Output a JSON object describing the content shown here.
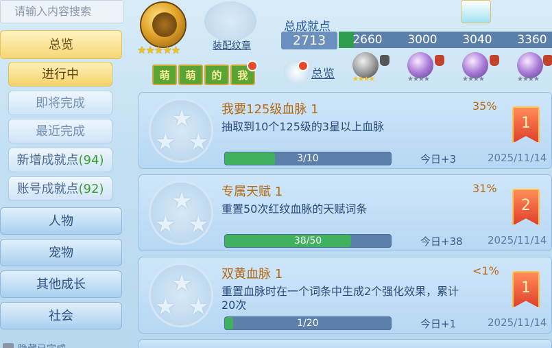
{
  "search": {
    "placeholder": "请输入内容搜索"
  },
  "sidebar": {
    "overview": "总览",
    "in_progress": "进行中",
    "about_to_finish": "即将完成",
    "recently_done": "最近完成",
    "new_points_label": "新增成就点",
    "new_points_count": "(94)",
    "account_points_label": "账号成就点",
    "account_points_count": "(92)",
    "categories": [
      "人物",
      "宠物",
      "其他成长",
      "社会"
    ],
    "hide_completed_label": "隐藏已完成"
  },
  "header": {
    "medal_stars": 5,
    "meng_tags": [
      "萌",
      "萌",
      "的",
      "我"
    ],
    "equip_label": "装配纹章",
    "total_title": "总成就点",
    "total_value": "2713",
    "milestones": [
      "2660",
      "3000",
      "3040",
      "3360"
    ],
    "milestone_progress_fraction": 0.07,
    "overview_link": "总览"
  },
  "colors": {
    "accent_gold": "#b4690f",
    "progress_green": "#3fb15f",
    "count_green": "#3a9f2e",
    "ribbon_red": "#e0402a"
  },
  "achievements": [
    {
      "title": "我要125级血脉 1",
      "percent": "35%",
      "description": "抽取到10个125级的3星以上血脉",
      "progress_text": "3/10",
      "progress": 0.3,
      "today": "今日+3",
      "date": "2025/11/14",
      "rank": "1"
    },
    {
      "title": "专属天赋 1",
      "percent": "31%",
      "description": "重置50次红纹血脉的天赋词条",
      "progress_text": "38/50",
      "progress": 0.76,
      "today": "今日+38",
      "date": "2025/11/14",
      "rank": "2"
    },
    {
      "title": "双黄血脉 1",
      "percent": "<1%",
      "description": "重置血脉时在一个词条中生成2个强化效果，累计20次",
      "progress_text": "1/20",
      "progress": 0.05,
      "today": "今日+1",
      "date": "2025/11/14",
      "rank": "1"
    }
  ]
}
